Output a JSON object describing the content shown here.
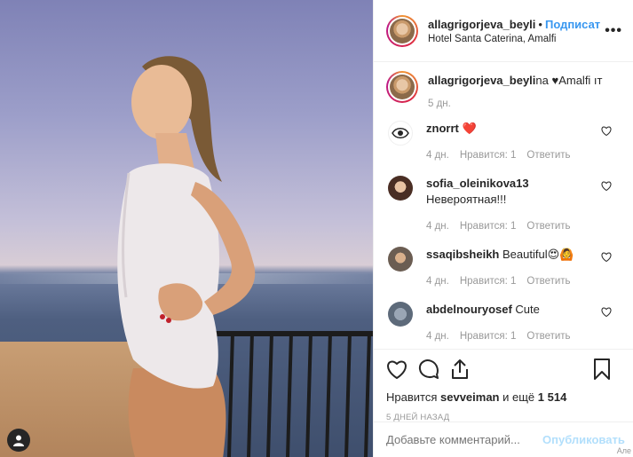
{
  "header": {
    "username": "allagrigorjeva_beyli",
    "dot": "•",
    "follow_label": "Подписаться",
    "location": "Hotel Santa Caterina, Amalfi",
    "more_label": "•••"
  },
  "caption": {
    "username": "allagrigorjeva_beyli",
    "text": "na ♥Amalfi ıт",
    "time": "5 дн."
  },
  "comments": [
    {
      "username": "znorrt",
      "text": "❤️",
      "time": "4 дн.",
      "likes": "Нравится: 1",
      "reply": "Ответить",
      "avatar_icon": "eye-icon"
    },
    {
      "username": "sofia_oleinikova13",
      "text": "Невероятная!!!",
      "time": "4 дн.",
      "likes": "Нравится: 1",
      "reply": "Ответить",
      "avatar_icon": "photo-avatar"
    },
    {
      "username": "ssaqibsheikh",
      "text": "Beautiful😍🙆",
      "time": "4 дн.",
      "likes": "Нравится: 1",
      "reply": "Ответить",
      "avatar_icon": "photo-avatar"
    },
    {
      "username": "abdelnouryosef",
      "text": "Cute",
      "time": "4 дн.",
      "likes": "Нравится: 1",
      "reply": "Ответить",
      "avatar_icon": "photo-avatar"
    }
  ],
  "actions": {
    "likes_prefix": "Нравится",
    "likes_user": "sevveiman",
    "likes_mid": "и ещё",
    "likes_count": "1 514",
    "ago": "5 ДНЕЙ НАЗАД"
  },
  "add_comment": {
    "placeholder": "Добавьте комментарий...",
    "publish_label": "Опубликовать"
  },
  "corner_label": "Але",
  "colors": {
    "accent": "#3897f0",
    "publish_disabled": "#b2dffc",
    "muted": "#999999"
  }
}
